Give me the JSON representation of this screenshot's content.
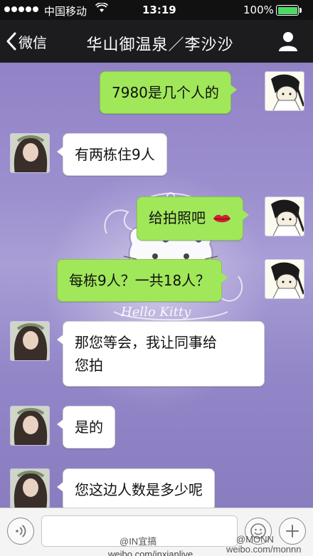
{
  "status_bar": {
    "carrier": "中国移动",
    "time": "13:19",
    "battery": "100%",
    "battery_level": 1.0,
    "colors": {
      "background": "#111111",
      "battery_fill": "#4cd964"
    }
  },
  "nav": {
    "back_label": "微信",
    "title": "华山御温泉／李沙沙",
    "icons": {
      "back": "chevron-left-icon",
      "contact": "person-icon"
    }
  },
  "chat": {
    "wallpaper_brand": "Hello Kitty",
    "colors": {
      "sent_bubble": "#a0e75a",
      "received_bubble": "#ffffff",
      "wallpaper": "#9182c6"
    },
    "messages": [
      {
        "side": "sent",
        "text": "7980是几个人的"
      },
      {
        "side": "received",
        "text": "有两栋住9人"
      },
      {
        "side": "sent",
        "text": "给拍照吧",
        "emoji": "lips-icon"
      },
      {
        "side": "sent",
        "text": "每栋9人？一共18人？"
      },
      {
        "side": "received",
        "line1": "那您等会，我让同事给",
        "line2": "您拍"
      },
      {
        "side": "received",
        "text": "是的"
      },
      {
        "side": "received",
        "text": "您这边人数是多少呢"
      }
    ]
  },
  "input_bar": {
    "watermark_1": "@IN宜搞",
    "watermark_2": "weibo.com/inxianlive",
    "watermark_3": "@MONN",
    "watermark_4": "weibo.com/monnn",
    "icons": {
      "voice": "voice-icon",
      "emoji": "smiley-icon",
      "more": "plus-icon"
    }
  }
}
